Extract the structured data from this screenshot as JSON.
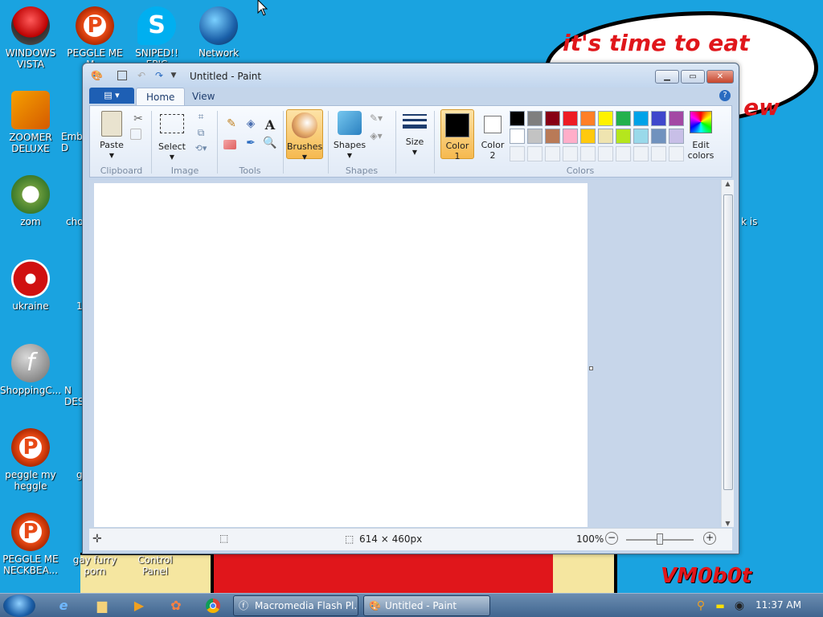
{
  "desktop": {
    "icons_left": [
      {
        "label": "WINDOWS VISTA"
      },
      {
        "label": "ZOOMER DELUXE"
      },
      {
        "label": "zom"
      },
      {
        "label": "ukraine"
      },
      {
        "label": "ShoppingC..."
      },
      {
        "label": "peggle my heggle"
      },
      {
        "label": "PEGGLE ME NECKBEA..."
      }
    ],
    "icons_top": [
      {
        "label": "PEGGLE ME M..."
      },
      {
        "label": "SNIPED!! EPIC"
      },
      {
        "label": "Network"
      }
    ],
    "icons_bottom": [
      {
        "label": "gay furry porn"
      },
      {
        "label": "Control Panel"
      }
    ],
    "partial_labels": [
      "Emb D",
      "cho",
      "1",
      "N DES",
      "g",
      "k is"
    ],
    "bubble_line1": "it's time to eat shit",
    "bubble_line2": "ew",
    "signature": "VM0b0t"
  },
  "window": {
    "title": "Untitled - Paint",
    "tabs": [
      {
        "label": "Home"
      },
      {
        "label": "View"
      }
    ],
    "groups": {
      "clipboard": "Clipboard",
      "image": "Image",
      "tools": "Tools",
      "shapes": "Shapes",
      "colors": "Colors"
    },
    "buttons": {
      "paste": "Paste",
      "select": "Select",
      "brushes": "Brushes",
      "shapes": "Shapes",
      "size": "Size",
      "color1_a": "Color",
      "color1_b": "1",
      "color2_a": "Color",
      "color2_b": "2",
      "edit_a": "Edit",
      "edit_b": "colors"
    },
    "status": {
      "dimensions": "614 × 460px",
      "zoom": "100%"
    },
    "colors": {
      "color1": "#000000",
      "color2": "#ffffff",
      "palette_row1": [
        "#000000",
        "#7f7f7f",
        "#880015",
        "#ed1c24",
        "#ff7f27",
        "#fff200",
        "#22b14c",
        "#00a2e8",
        "#3f48cc",
        "#a349a4"
      ],
      "palette_row2": [
        "#ffffff",
        "#c3c3c3",
        "#b97a57",
        "#ffaec9",
        "#ffc90e",
        "#efe4b0",
        "#b5e61d",
        "#99d9ea",
        "#7092be",
        "#c8bfe7"
      ]
    }
  },
  "taskbar": {
    "tasks": [
      {
        "label": "Macromedia Flash Pl..."
      },
      {
        "label": "Untitled - Paint"
      }
    ],
    "clock": "11:37 AM"
  }
}
